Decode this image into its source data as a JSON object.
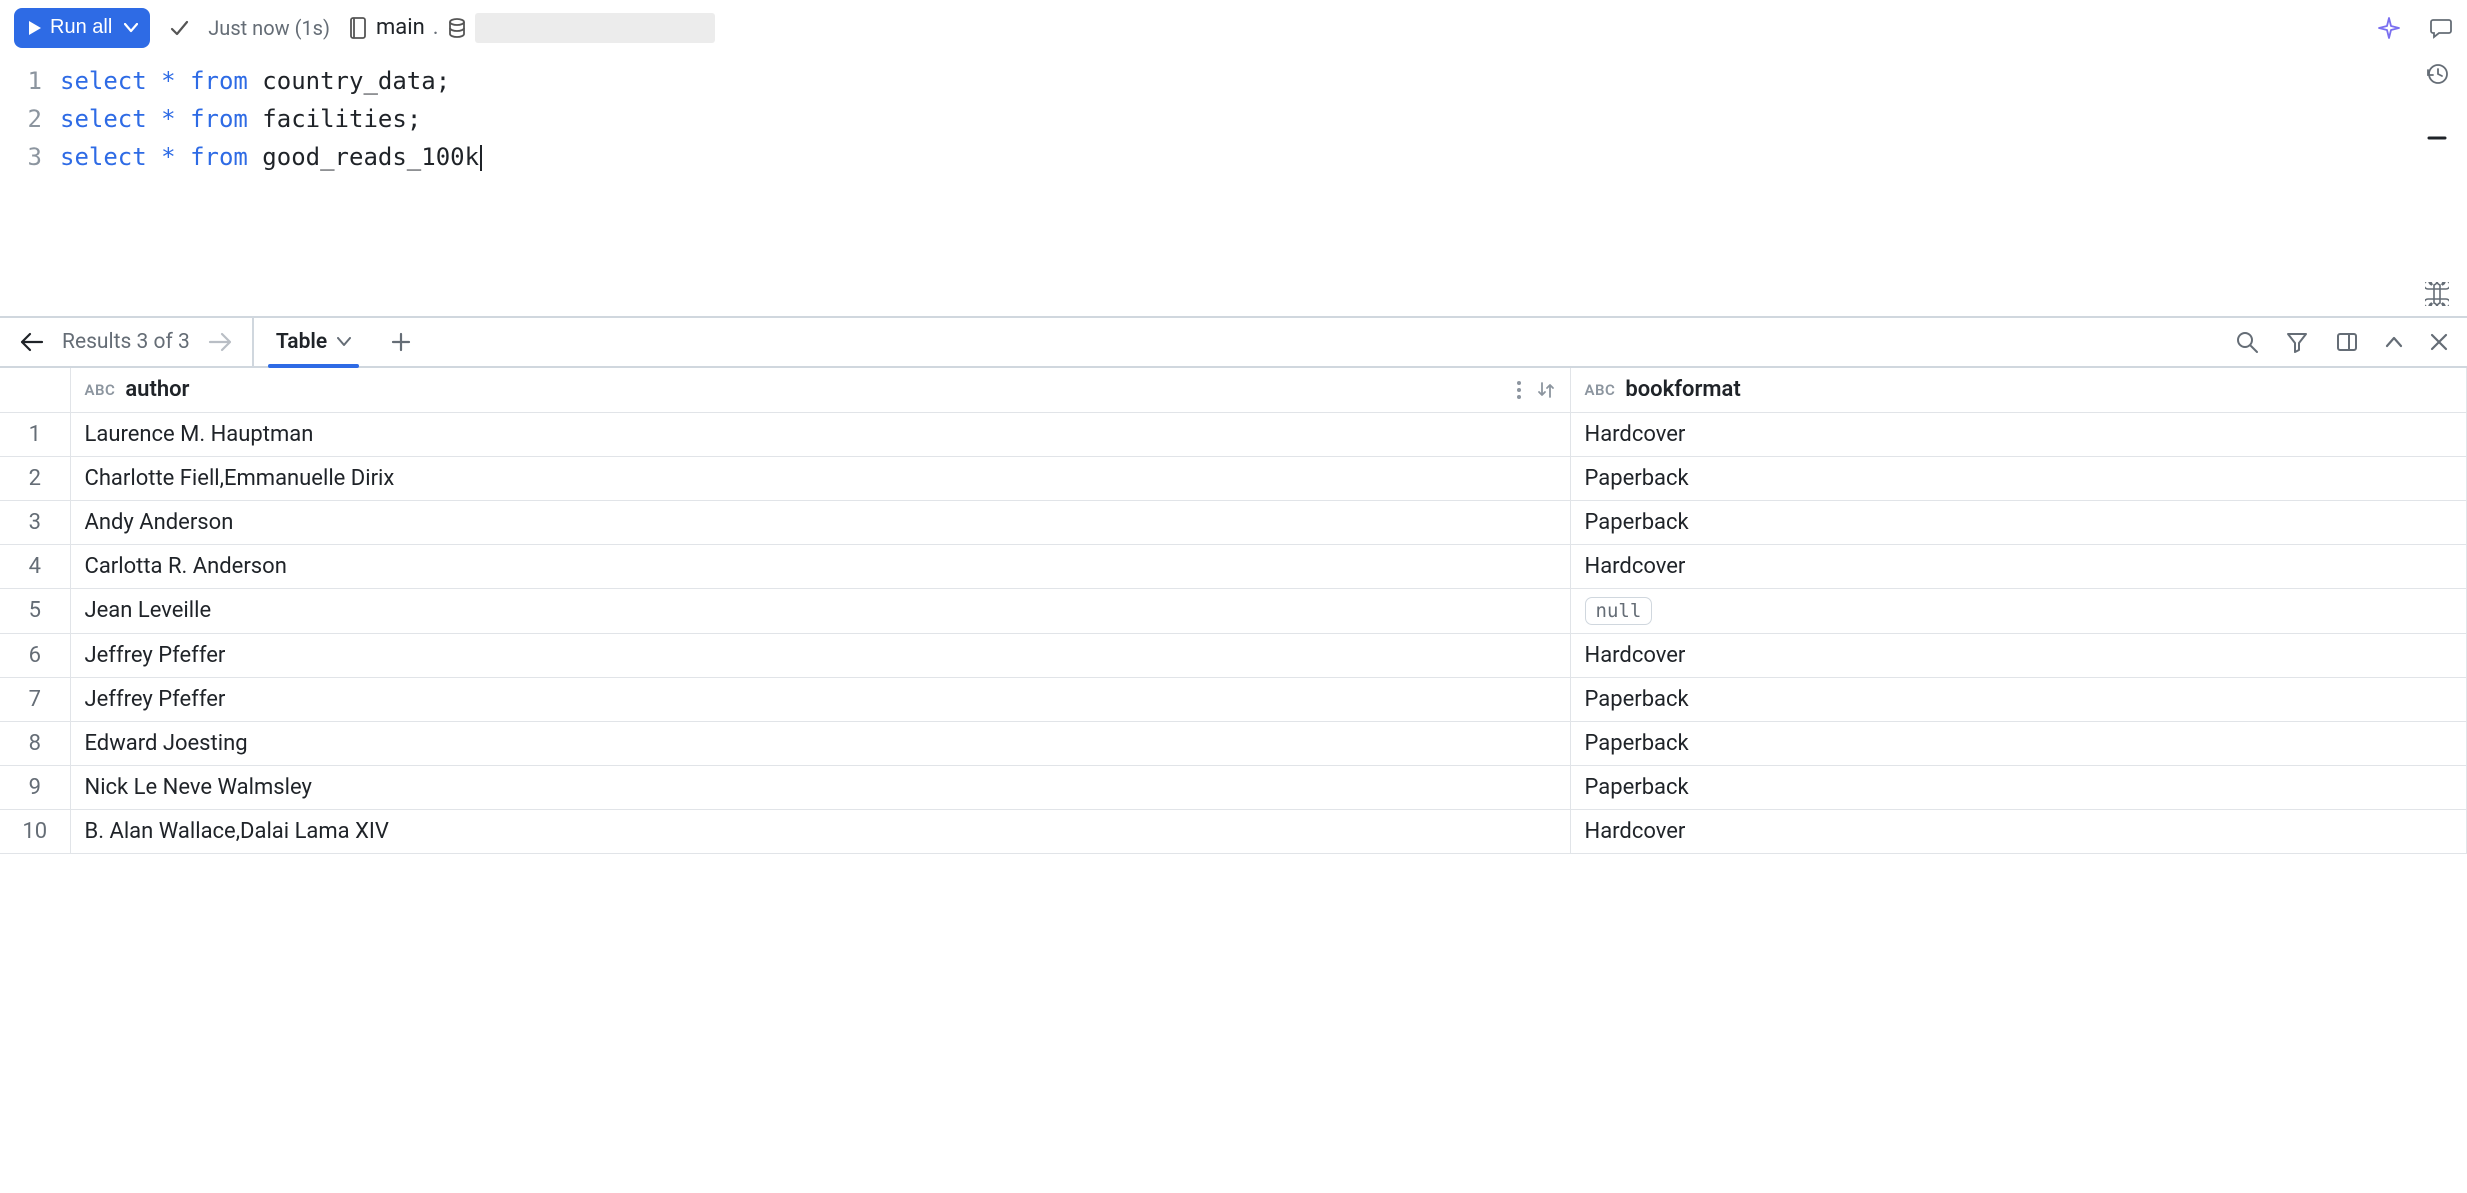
{
  "toolbar": {
    "run_label": "Run all",
    "status_time": "Just now (1s)",
    "catalog": "main",
    "separator": "."
  },
  "editor": {
    "lines": [
      {
        "n": "1",
        "kw1": "select",
        "op": " * ",
        "kw2": "from",
        "ident": " country_data",
        "tail": ";"
      },
      {
        "n": "2",
        "kw1": "select",
        "op": " * ",
        "kw2": "from",
        "ident": " facilities",
        "tail": ";"
      },
      {
        "n": "3",
        "kw1": "select",
        "op": " * ",
        "kw2": "from",
        "ident": " good_reads_100k",
        "tail": ""
      }
    ]
  },
  "results": {
    "counter": "Results 3 of 3",
    "tab_label": "Table"
  },
  "columns": {
    "author_type": "ABC",
    "author_label": "author",
    "bookformat_type": "ABC",
    "bookformat_label": "bookformat"
  },
  "rows": [
    {
      "n": "1",
      "author": "Laurence M. Hauptman",
      "bookformat": "Hardcover"
    },
    {
      "n": "2",
      "author": "Charlotte Fiell,Emmanuelle Dirix",
      "bookformat": "Paperback"
    },
    {
      "n": "3",
      "author": "Andy Anderson",
      "bookformat": "Paperback"
    },
    {
      "n": "4",
      "author": "Carlotta R. Anderson",
      "bookformat": "Hardcover"
    },
    {
      "n": "5",
      "author": "Jean Leveille",
      "bookformat": null
    },
    {
      "n": "6",
      "author": "Jeffrey Pfeffer",
      "bookformat": "Hardcover"
    },
    {
      "n": "7",
      "author": "Jeffrey Pfeffer",
      "bookformat": "Paperback"
    },
    {
      "n": "8",
      "author": "Edward Joesting",
      "bookformat": "Paperback"
    },
    {
      "n": "9",
      "author": "Nick Le Neve Walmsley",
      "bookformat": "Paperback"
    },
    {
      "n": "10",
      "author": "B. Alan Wallace,Dalai Lama XIV",
      "bookformat": "Hardcover"
    }
  ],
  "null_label": "null"
}
